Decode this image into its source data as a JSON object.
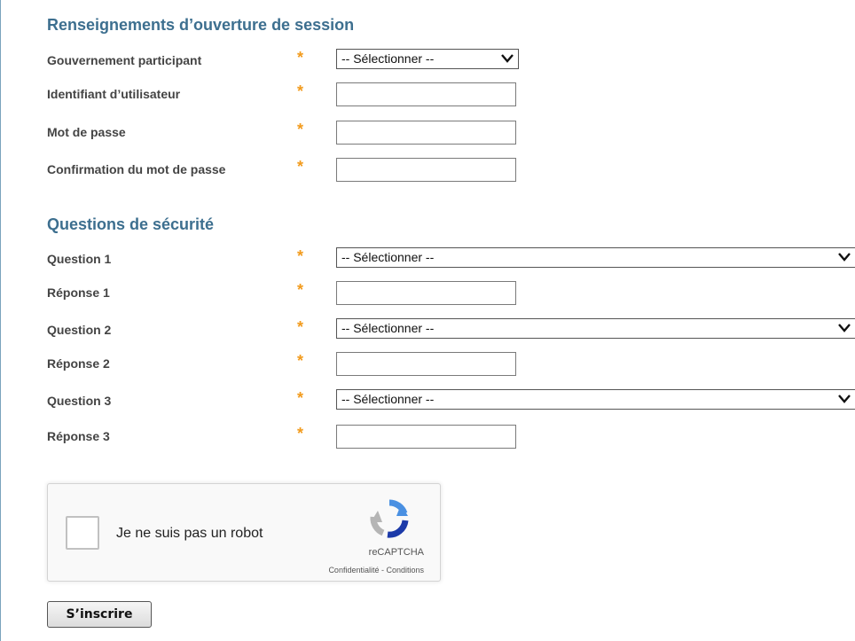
{
  "login_section": {
    "title": "Renseignements d’ouverture de session",
    "required_marker": "*",
    "fields": [
      {
        "label": "Gouvernement participant",
        "type": "select",
        "value": "-- Sélectionner --"
      },
      {
        "label": "Identifiant d’utilisateur",
        "type": "text",
        "value": ""
      },
      {
        "label": "Mot de passe",
        "type": "password",
        "value": ""
      },
      {
        "label": "Confirmation du mot de passe",
        "type": "password",
        "value": ""
      }
    ]
  },
  "security_section": {
    "title": "Questions de sécurité",
    "fields": [
      {
        "label": "Question 1",
        "type": "select",
        "value": "-- Sélectionner --"
      },
      {
        "label": "Réponse 1",
        "type": "text",
        "value": ""
      },
      {
        "label": "Question 2",
        "type": "select",
        "value": "-- Sélectionner --"
      },
      {
        "label": "Réponse 2",
        "type": "text",
        "value": ""
      },
      {
        "label": "Question 3",
        "type": "select",
        "value": "-- Sélectionner --"
      },
      {
        "label": "Réponse 3",
        "type": "text",
        "value": ""
      }
    ]
  },
  "captcha": {
    "label": "Je ne suis pas un robot",
    "brand": "reCAPTCHA",
    "terms": "Confidentialité - Conditions",
    "checked": false
  },
  "submit_label": "S’inscrire",
  "colors": {
    "section_title": "#3d6f8f",
    "required_marker": "#f29b1d",
    "label_text": "#444444"
  },
  "icons": {
    "select_arrow": "chevron-down-icon",
    "captcha_logo": "recaptcha-logo-icon"
  }
}
